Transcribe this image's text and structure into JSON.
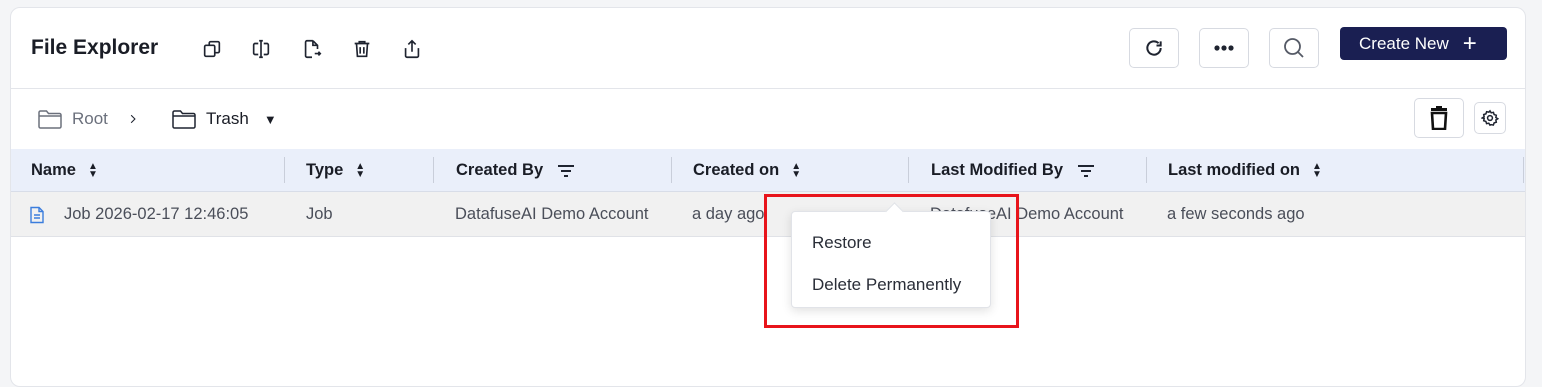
{
  "header": {
    "title": "File Explorer",
    "create_label": "Create New"
  },
  "breadcrumb": {
    "root": "Root",
    "current": "Trash"
  },
  "table": {
    "columns": [
      "Name",
      "Type",
      "Created By",
      "Created on",
      "Last Modified By",
      "Last modified on"
    ],
    "rows": [
      {
        "name": "Job 2026-02-17 12:46:05",
        "type": "Job",
        "created_by": "DatafuseAI Demo Account",
        "created_on": "a day ago",
        "last_modified_by": "DatafuseAI Demo Account",
        "last_modified_on": "a few seconds ago"
      }
    ]
  },
  "context_menu": {
    "items": [
      "Restore",
      "Delete Permanently"
    ]
  },
  "colors": {
    "accent": "#1a1f52",
    "header_bg": "#eaeffa",
    "highlight": "#e8141b",
    "file_icon": "#3b7ddd"
  }
}
